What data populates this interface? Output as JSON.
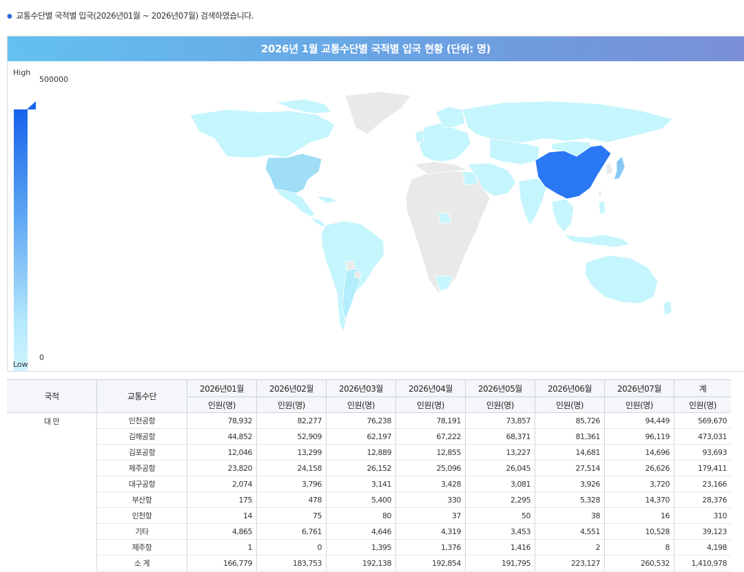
{
  "search_info": "교통수단별 국적별 입국(2026년01월 ~ 2026년07월) 검색하였습니다.",
  "map": {
    "title": "2026년 1월 교통수단별 국적별 입국 현황 (단위: 명)",
    "legend": {
      "high_label": "High",
      "low_label": "Low",
      "max_value": "500000",
      "min_value": "0"
    },
    "colors": {
      "high": "#1663ec",
      "low": "#d1f6fe",
      "nodata": "#e9e9e9",
      "china": "#2b78f5",
      "usa": "#9fdef5",
      "japan": "#85c8f5"
    }
  },
  "table": {
    "col_nation": "국적",
    "col_mode": "교통수단",
    "months": [
      "2026년01월",
      "2026년02월",
      "2026년03월",
      "2026년04월",
      "2026년05월",
      "2026년06월",
      "2026년07월",
      "계"
    ],
    "unit": "인원(명)",
    "nation": "대 만",
    "rows": [
      {
        "mode": "인천공항",
        "values": [
          "78,932",
          "82,277",
          "76,238",
          "78,191",
          "73,857",
          "85,726",
          "94,449",
          "569,670"
        ]
      },
      {
        "mode": "김해공항",
        "values": [
          "44,852",
          "52,909",
          "62,197",
          "67,222",
          "68,371",
          "81,361",
          "96,119",
          "473,031"
        ]
      },
      {
        "mode": "김포공항",
        "values": [
          "12,046",
          "13,299",
          "12,889",
          "12,855",
          "13,227",
          "14,681",
          "14,696",
          "93,693"
        ]
      },
      {
        "mode": "제주공항",
        "values": [
          "23,820",
          "24,158",
          "26,152",
          "25,096",
          "26,045",
          "27,514",
          "26,626",
          "179,411"
        ]
      },
      {
        "mode": "대구공항",
        "values": [
          "2,074",
          "3,796",
          "3,141",
          "3,428",
          "3,081",
          "3,926",
          "3,720",
          "23,166"
        ]
      },
      {
        "mode": "부산항",
        "values": [
          "175",
          "478",
          "5,400",
          "330",
          "2,295",
          "5,328",
          "14,370",
          "28,376"
        ]
      },
      {
        "mode": "인천항",
        "values": [
          "14",
          "75",
          "80",
          "37",
          "50",
          "38",
          "16",
          "310"
        ]
      },
      {
        "mode": "기타",
        "values": [
          "4,865",
          "6,761",
          "4,646",
          "4,319",
          "3,453",
          "4,551",
          "10,528",
          "39,123"
        ]
      },
      {
        "mode": "제주항",
        "values": [
          "1",
          "0",
          "1,395",
          "1,376",
          "1,416",
          "2",
          "8",
          "4,198"
        ]
      },
      {
        "mode": "소 계",
        "values": [
          "166,779",
          "183,753",
          "192,138",
          "192,854",
          "191,795",
          "223,127",
          "260,532",
          "1,410,978"
        ]
      }
    ]
  }
}
